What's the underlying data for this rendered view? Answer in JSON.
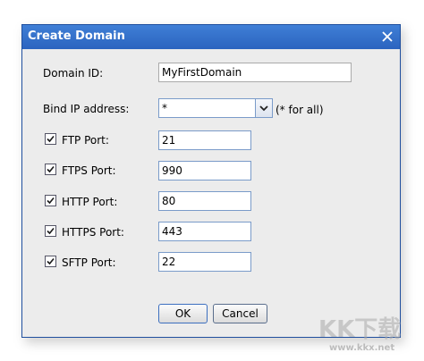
{
  "dialog": {
    "title": "Create Domain",
    "domain_id_label": "Domain ID:",
    "domain_id_value": "MyFirstDomain",
    "bind_ip_label": "Bind IP address:",
    "bind_ip_value": "*",
    "bind_ip_hint": "(* for all)",
    "ports": [
      {
        "label": "FTP Port:",
        "value": "21",
        "checked": true
      },
      {
        "label": "FTPS Port:",
        "value": "990",
        "checked": true
      },
      {
        "label": "HTTP Port:",
        "value": "80",
        "checked": true
      },
      {
        "label": "HTTPS Port:",
        "value": "443",
        "checked": true
      },
      {
        "label": "SFTP Port:",
        "value": "22",
        "checked": true
      }
    ],
    "ok_label": "OK",
    "cancel_label": "Cancel"
  },
  "watermark": {
    "logo_text": "KK下载",
    "url": "www.kkx.net"
  },
  "colors": {
    "titlebar": "#2b64bf",
    "dialog_bg": "#ececec",
    "input_border": "#7a9bc9"
  }
}
